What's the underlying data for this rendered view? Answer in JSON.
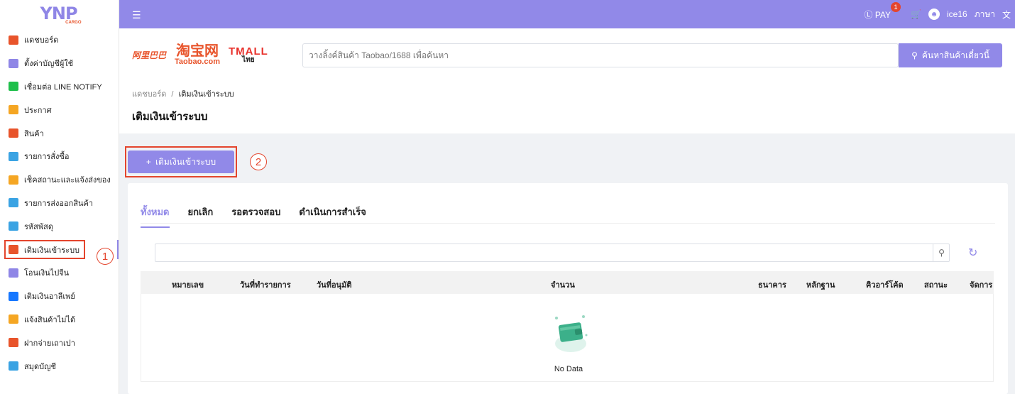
{
  "logo": {
    "main": "YNP",
    "sub": "CARGO"
  },
  "sidebar": {
    "items": [
      {
        "label": "แดชบอร์ด",
        "icon": "chart-icon",
        "color": "#e8542b"
      },
      {
        "label": "ตั้งค่าบัญชีผู้ใช้",
        "icon": "user-settings-icon",
        "color": "#8f86e6"
      },
      {
        "label": "เชื่อมต่อ LINE NOTIFY",
        "icon": "line-icon",
        "color": "#1fbf4b"
      },
      {
        "label": "ประกาศ",
        "icon": "megaphone-icon",
        "color": "#f5a623"
      },
      {
        "label": "สินค้า",
        "icon": "box-icon",
        "color": "#e8542b"
      },
      {
        "label": "รายการสั่งซื้อ",
        "icon": "cart-icon",
        "color": "#3aa3e3"
      },
      {
        "label": "เช็คสถานะและแจ้งส่งของ",
        "icon": "truck-icon",
        "color": "#f5a623"
      },
      {
        "label": "รายการส่งออกสินค้า",
        "icon": "export-icon",
        "color": "#3aa3e3"
      },
      {
        "label": "รหัสพัสดุ",
        "icon": "cube-icon",
        "color": "#3aa3e3"
      },
      {
        "label": "เติมเงินเข้าระบบ",
        "icon": "piggy-bank-icon",
        "color": "#e8542b"
      },
      {
        "label": "โอนเงินไปจีน",
        "icon": "yuan-icon",
        "color": "#8f86e6"
      },
      {
        "label": "เติมเงินอาลีเพย์",
        "icon": "alipay-icon",
        "color": "#1677ff"
      },
      {
        "label": "แจ้งสินค้าไม่ได้",
        "icon": "flag-icon",
        "color": "#f5a623"
      },
      {
        "label": "ฝากจ่ายเถาเปา",
        "icon": "taobao-icon",
        "color": "#e8542b"
      },
      {
        "label": "สมุดบัญชี",
        "icon": "wallet-icon",
        "color": "#3aa3e3"
      }
    ],
    "active_index": 9,
    "marker": "1"
  },
  "topbar": {
    "menu_icon": "menu-fold-icon",
    "pay_label": "PAY",
    "pay_badge": "1",
    "username": "ice16",
    "language_label": "ภาษา",
    "accent": "#9189e8"
  },
  "brands": {
    "alibaba": "阿里巴巴",
    "taobao_cn": "淘宝网",
    "taobao_en": "Taobao.com",
    "tmall": "TMALL",
    "tmall_sub": "ไทย"
  },
  "search": {
    "placeholder": "วางลิ้งค์สินค้า Taobao/1688 เพื่อค้นหา",
    "button_label": "ค้นหาสินค้าเดี๋ยวนี้"
  },
  "breadcrumb": {
    "home": "แดชบอร์ด",
    "separator": "/",
    "current": "เติมเงินเข้าระบบ"
  },
  "page_title": "เติมเงินเข้าระบบ",
  "topup_button": {
    "label": "เติมเงินเข้าระบบ",
    "marker": "2"
  },
  "tabs": [
    "ทั้งหมด",
    "ยกเลิก",
    "รอตรวจสอบ",
    "ดำเนินการสำเร็จ"
  ],
  "table": {
    "columns": [
      "หมายเลข",
      "วันที่ทำรายการ",
      "วันที่อนุมัติ",
      "จำนวน",
      "ธนาคาร",
      "หลักฐาน",
      "คิวอาร์โค้ด",
      "สถานะ",
      "จัดการ"
    ],
    "empty_text": "No Data"
  }
}
